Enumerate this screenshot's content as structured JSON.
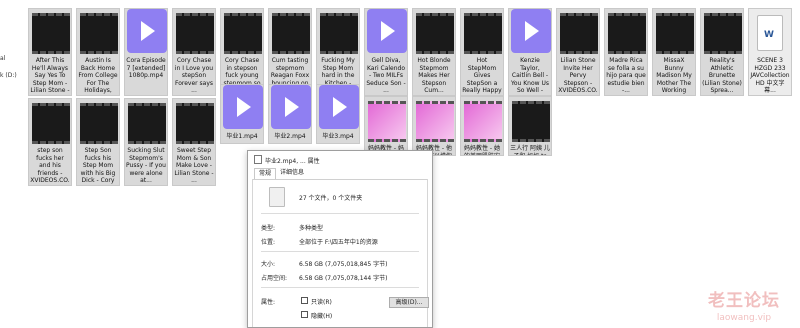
{
  "nav": {
    "items": [
      "al",
      "k (D:)"
    ]
  },
  "files": [
    {
      "name": "After This He'll Always Say Yes To Step Mom - Lilian Stone -",
      "kind": "video"
    },
    {
      "name": "Austin Is Back Home From College For The Holidays, Excit...",
      "kind": "video"
    },
    {
      "name": "Cora Episode 7 [extended] 1080p.mp4",
      "kind": "app"
    },
    {
      "name": "Cory Chase in I Love you stepSon Forever says ...",
      "kind": "video"
    },
    {
      "name": "Cory Chase in stepson fuck young stepmom so ...",
      "kind": "video"
    },
    {
      "name": "Cum tasting stepmom Reagan Foxx bouncing on ...",
      "kind": "video"
    },
    {
      "name": "Fucking My Step Mom hard in the Kitchen - Cory Chase - ...",
      "kind": "video"
    },
    {
      "name": "Gell Diva, Kari Calendo - Two MILFs Seduce Son - ...",
      "kind": "app"
    },
    {
      "name": "Hot Blonde Stepmom Makes Her Stepson Cum...",
      "kind": "video"
    },
    {
      "name": "Hot StepMom Gives StepSon a Really Happy Ending - XVID...",
      "kind": "video"
    },
    {
      "name": "Kenzie Taylor, Caitlin Bell - You Know Us So Well - Mo...",
      "kind": "app"
    },
    {
      "name": "Lilian Stone Invite Her Pervy Stepson - XVIDEOS.CO...",
      "kind": "video"
    },
    {
      "name": "Madre Rica se folla a su hijo para que estudie bien -...",
      "kind": "video"
    },
    {
      "name": "MissaX Bunny Madison My Mother The Working Girl.ts",
      "kind": "video"
    },
    {
      "name": "Reality's Athletic Brunette (Lilian Stone) Sprea...",
      "kind": "video"
    },
    {
      "name": "SCENE 3 HZGD 233 JAVCollectionHD 中文字幕...",
      "kind": "doc"
    },
    {
      "name": "step son fucks her and his friends - XVIDEOS.CO...",
      "kind": "video"
    },
    {
      "name": "Step Son fucks his Step Mom with his Big Dick - Cory C...",
      "kind": "video"
    },
    {
      "name": "Sucking Slut Stepmom's Pussy - If you were alone at...",
      "kind": "video"
    },
    {
      "name": "Sweet Step Mom & Son Make Love - Lilian Stone - ...",
      "kind": "video"
    },
    {
      "name": "毕业1.mp4",
      "kind": "app"
    },
    {
      "name": "毕业2.mp4",
      "kind": "app"
    },
    {
      "name": "毕业3.mp4",
      "kind": "app"
    },
    {
      "name": "妈妈教性 - 妈妈教儿子怎麼激發你的魅惑.ts",
      "kind": "video"
    },
    {
      "name": "妈妈教性 - 他终于可以摸你的膝盖了 .ts",
      "kind": "video"
    },
    {
      "name": "妈妈教性 - 她的美丽肌肤宏想抱你的奶子.ts",
      "kind": "video"
    },
    {
      "name": "三人行 阿姨 儿子和 妈妈.ts",
      "kind": "video"
    }
  ],
  "dialog": {
    "title": "毕业2.mp4, ... 属性",
    "tabs": [
      "常规",
      "详细信息"
    ],
    "summary": "27 个文件，0 个文件夹",
    "fields": [
      {
        "label": "类型:",
        "value": "多种类型"
      },
      {
        "label": "位置:",
        "value": "全部位于 F:\\四五年中1的资源"
      },
      {
        "label": "大小:",
        "value": "6.58 GB (7,075,018,845 字节)"
      },
      {
        "label": "占用空间:",
        "value": "6.58 GB (7,075,078,144 字节)"
      }
    ],
    "attributes_label": "属性:",
    "readonly_label": "只读(R)",
    "hidden_label": "隐藏(H)",
    "advanced_button": "高级(D)..."
  },
  "watermark": {
    "line1": "老王论坛",
    "line2": "laowang.vip"
  }
}
